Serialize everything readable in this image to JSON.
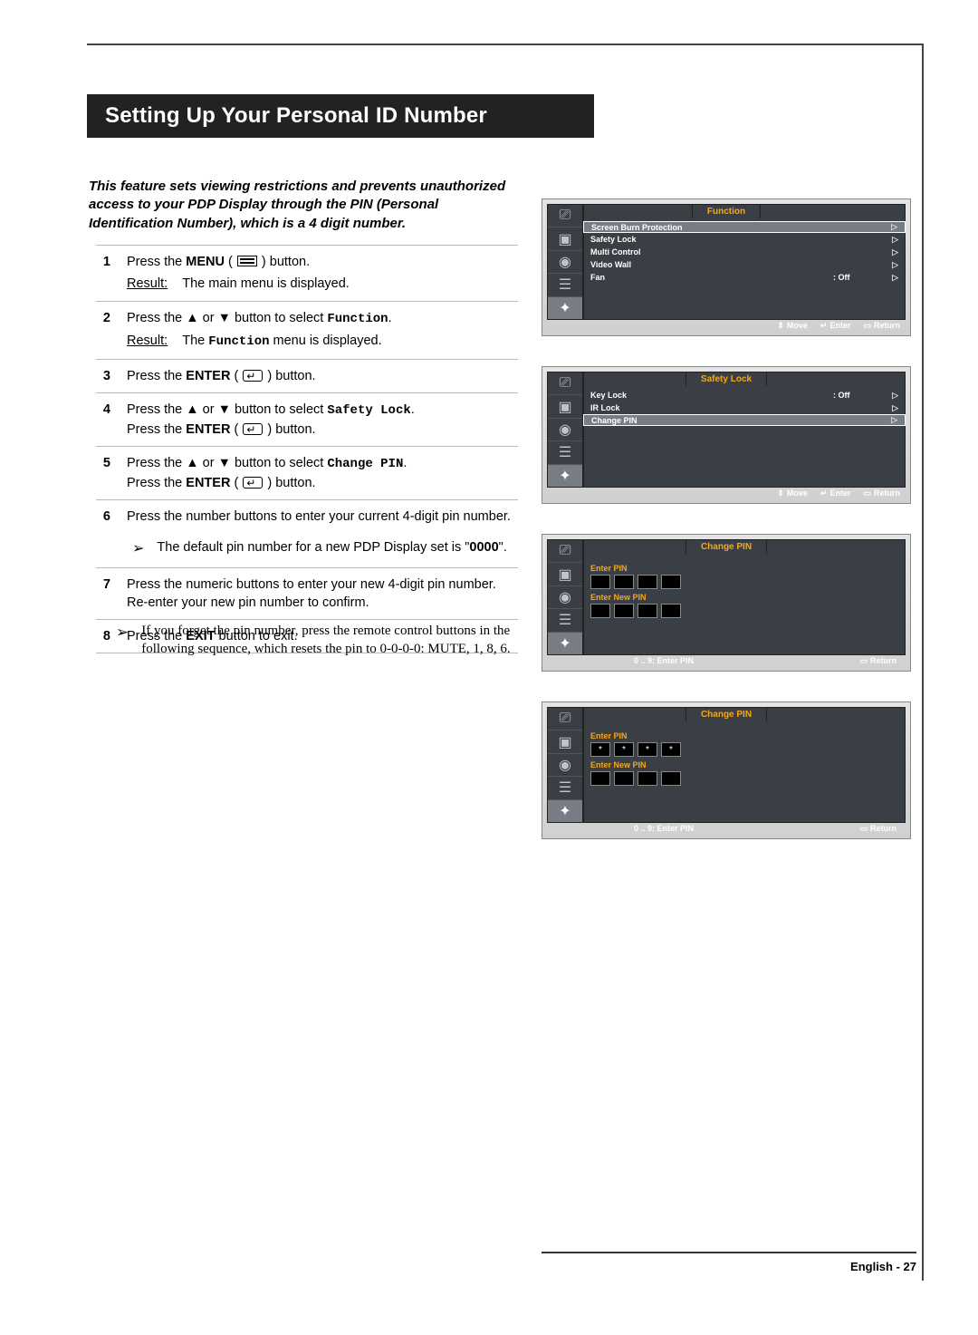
{
  "title": "Setting Up Your Personal ID Number",
  "intro": "This feature sets viewing restrictions and prevents unauthorized access to your PDP Display through the PIN (Personal Identification Number), which is a 4 digit number.",
  "steps": {
    "s1_a": "Press the ",
    "s1_key": "MENU",
    "s1_b": " ( ",
    "s1_c": " ) button.",
    "s1_res_label": "Result:",
    "s1_res": "The main menu is displayed.",
    "s2_a": "Press the ▲ or ▼ button to select ",
    "s2_key": "Function",
    "s2_b": ".",
    "s2_res_label": "Result:",
    "s2_res_a": "The ",
    "s2_res_key": "Function",
    "s2_res_b": " menu is displayed.",
    "s3_a": "Press the ",
    "s3_key": "ENTER",
    "s3_b": " ( ",
    "s3_c": " ) button.",
    "s4_a": "Press the ▲ or ▼ button to select ",
    "s4_key": "Safety Lock",
    "s4_b": ".",
    "s4_c": "Press the ",
    "s4_key2": "ENTER",
    "s4_d": " ( ",
    "s4_e": " ) button.",
    "s5_a": "Press the ▲ or ▼ button to select ",
    "s5_key": "Change PIN",
    "s5_b": ".",
    "s5_c": "Press the ",
    "s5_key2": "ENTER",
    "s5_d": " ( ",
    "s5_e": " ) button.",
    "s6": "Press the number buttons to enter your current 4-digit pin number.",
    "s6_note_a": "The default pin number for a new PDP Display set is \"",
    "s6_note_key": "0000",
    "s6_note_b": "\".",
    "s7_a": "Press the numeric buttons to enter your new 4-digit pin number.",
    "s7_b": "Re-enter your new pin number to confirm.",
    "s8_a": "Press the ",
    "s8_key": "EXIT",
    "s8_b": " button to exit."
  },
  "forget_note": "If you forget the pin number, press the remote control buttons in the following sequence, which resets the pin to 0-0-0-0: MUTE, 1, 8, 6.",
  "osd1": {
    "title": "Function",
    "items": [
      {
        "label": "Screen Burn Protection",
        "val": "",
        "arr": "▷",
        "hl": true
      },
      {
        "label": "Safety Lock",
        "val": "",
        "arr": "▷"
      },
      {
        "label": "Multi Control",
        "val": "",
        "arr": "▷"
      },
      {
        "label": "Video Wall",
        "val": "",
        "arr": "▷"
      },
      {
        "label": "Fan",
        "val": ": Off",
        "arr": "▷"
      }
    ],
    "footer": {
      "move": "Move",
      "enter": "Enter",
      "ret": "Return"
    }
  },
  "osd2": {
    "title": "Safety Lock",
    "items": [
      {
        "label": "Key Lock",
        "val": ": Off",
        "arr": "▷"
      },
      {
        "label": "IR Lock",
        "val": "",
        "arr": "▷"
      },
      {
        "label": "Change PIN",
        "val": "",
        "arr": "▷",
        "hl": true
      }
    ],
    "footer": {
      "move": "Move",
      "enter": "Enter",
      "ret": "Return"
    }
  },
  "osd3": {
    "title": "Change PIN",
    "enter_label": "Enter PIN",
    "new_label": "Enter New PIN",
    "pins1": [
      "",
      "",
      "",
      ""
    ],
    "pins2": [
      "",
      "",
      "",
      ""
    ],
    "footer": {
      "left": "0 .. 9: Enter PIN",
      "ret": "Return"
    }
  },
  "osd4": {
    "title": "Change PIN",
    "enter_label": "Enter PIN",
    "new_label": "Enter New PIN",
    "pins1": [
      "*",
      "*",
      "*",
      "*"
    ],
    "pins2": [
      "",
      "",
      "",
      ""
    ],
    "footer": {
      "left": "0 .. 9: Enter PIN",
      "ret": "Return"
    }
  },
  "footer": "English - 27"
}
